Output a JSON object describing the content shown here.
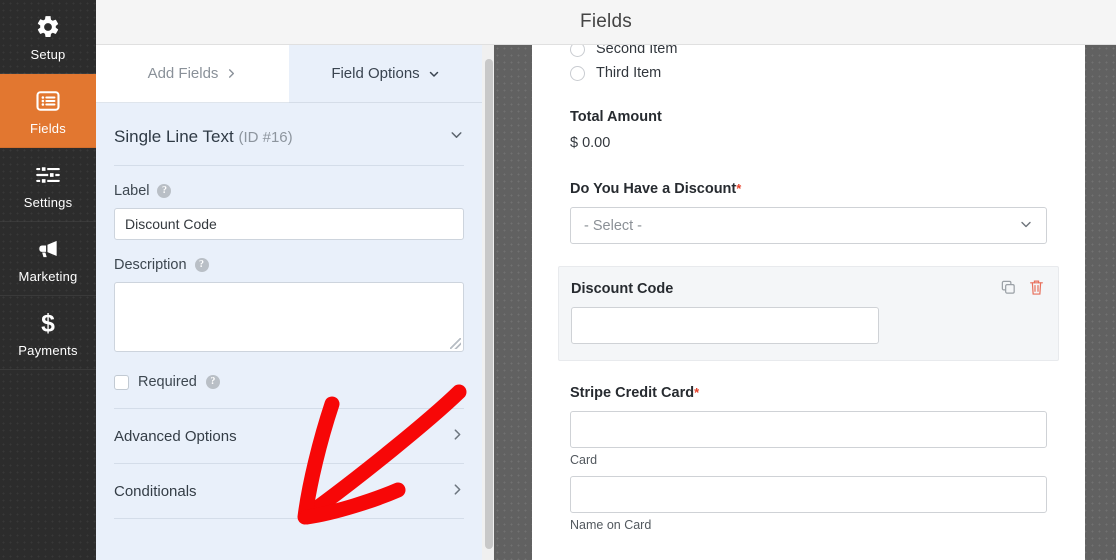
{
  "header": {
    "title": "Fields"
  },
  "sidebar": {
    "items": [
      {
        "label": "Setup",
        "icon": "gear-icon",
        "active": false
      },
      {
        "label": "Fields",
        "icon": "list-icon",
        "active": true
      },
      {
        "label": "Settings",
        "icon": "sliders-icon",
        "active": false
      },
      {
        "label": "Marketing",
        "icon": "megaphone-icon",
        "active": false
      },
      {
        "label": "Payments",
        "icon": "dollar-icon",
        "active": false
      }
    ],
    "active_color": "#e27730"
  },
  "panel": {
    "tabs": [
      {
        "label": "Add Fields",
        "icon": "chevron-right-icon",
        "selected": false
      },
      {
        "label": "Field Options",
        "icon": "chevron-down-icon",
        "selected": true
      }
    ],
    "field_header": {
      "type": "Single Line Text",
      "id": "(ID #16)",
      "toggle_icon": "chevron-down-icon"
    },
    "label_prop": {
      "label": "Label",
      "help": "?",
      "value": "Discount Code",
      "placeholder": ""
    },
    "description_prop": {
      "label": "Description",
      "help": "?",
      "value": "",
      "placeholder": ""
    },
    "required_prop": {
      "label": "Required",
      "help": "?",
      "checked": false
    },
    "accordions": [
      {
        "label": "Advanced Options",
        "icon": "chevron-right-icon"
      },
      {
        "label": "Conditionals",
        "icon": "chevron-right-icon"
      }
    ]
  },
  "preview": {
    "radios": [
      {
        "label": "Second Item"
      },
      {
        "label": "Third Item"
      }
    ],
    "total": {
      "label": "Total Amount",
      "value": "$ 0.00"
    },
    "discount_question": {
      "label": "Do You Have a Discount",
      "required_mark": "*",
      "select_value": "- Select -",
      "select_icon": "chevron-down-icon"
    },
    "discount_code_block": {
      "label": "Discount Code",
      "value": "",
      "duplicate_icon": "copy-icon",
      "delete_icon": "trash-icon",
      "delete_color": "#e8705c"
    },
    "stripe": {
      "label": "Stripe Credit Card",
      "required_mark": "*",
      "card_sub_label": "Card",
      "card_value": "",
      "name_sub_label": "Name on Card",
      "name_value": ""
    }
  },
  "annotation": {
    "arrow_color": "#f70707",
    "description": "red hand-drawn arrow pointing down-left at Conditionals row"
  }
}
